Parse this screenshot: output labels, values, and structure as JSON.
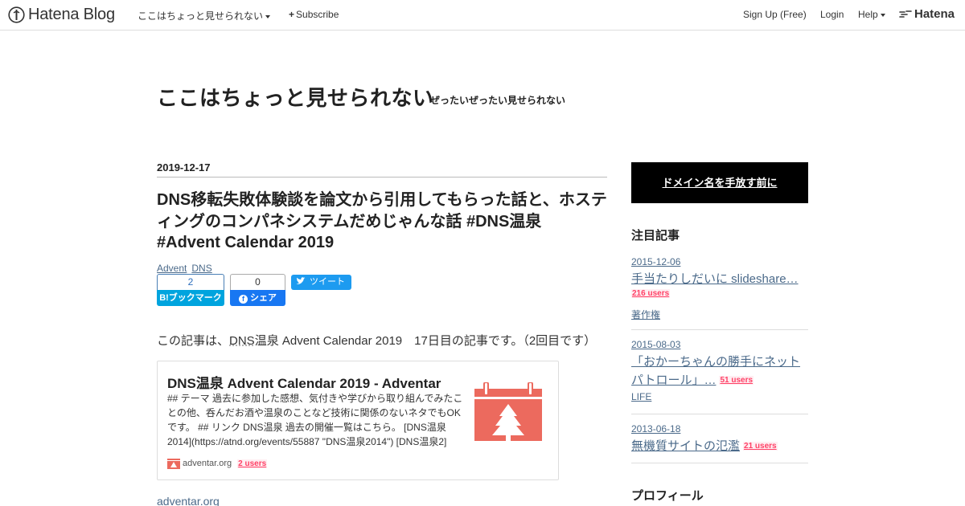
{
  "topbar": {
    "logo_text": "Hatena Blog",
    "blog_menu": "ここはちょっと見せられない",
    "subscribe": "Subscribe",
    "signup": "Sign Up (Free)",
    "login": "Login",
    "help": "Help",
    "hatena": "Hatena"
  },
  "blog": {
    "title": "ここはちょっと見せられない",
    "description": "ぜったいぜったい見せられない"
  },
  "entry": {
    "date": "2019-12-17",
    "title": "DNS移転失敗体験談を論文から引用してもらった話と、ホスティングのコンパネシステムだめじゃんな話 #DNS温泉 #Advent Calendar 2019",
    "categories": [
      "Advent",
      "DNS"
    ],
    "share": {
      "hatena_count": "2",
      "hatena_label": "B!ブックマーク",
      "fb_count": "0",
      "fb_label": "シェア",
      "tweet_label": "ツイート"
    },
    "intro_before": "この記事は、",
    "intro_dns": "DNS",
    "intro_after": "温泉 Advent Calendar 2019　17日目の記事です。（2回目です）",
    "embed": {
      "title": "DNS温泉 Advent Calendar 2019 - Adventar",
      "description": "## テーマ 過去に参加した感想、気付きや学びから取り組んでみたことの他、呑んだお酒や温泉のことなど技術に関係のないネタでもOKです。 ## リンク DNS温泉 過去の開催一覧はこちら。 [DNS温泉2014](https://atnd.org/events/55887 \"DNS温泉2014\") [DNS温泉2]",
      "domain": "adventar.org",
      "users": "2 users"
    },
    "source_link": "adventar.org"
  },
  "sidebar": {
    "banner": "ドメイン名を手放す前に",
    "featured_heading": "注目記事",
    "items": [
      {
        "date": "2015-12-06",
        "title": "手当たりしだいに slideshare…",
        "users": "216 users",
        "category": "著作権"
      },
      {
        "date": "2015-08-03",
        "title": "「おかーちゃんの勝手にネットパトロール」…",
        "users": "51 users",
        "category": "LIFE"
      },
      {
        "date": "2013-06-18",
        "title": "無機質サイトの氾濫",
        "users": "21 users",
        "category": ""
      }
    ],
    "profile_heading": "プロフィール"
  },
  "colors": {
    "accent_link": "#4b6a8a",
    "users_badge": "#ff4166",
    "hatena_blue": "#00a4de",
    "facebook": "#1877f2",
    "twitter": "#1d9bf0",
    "adventar_red": "#ec6a5e"
  }
}
